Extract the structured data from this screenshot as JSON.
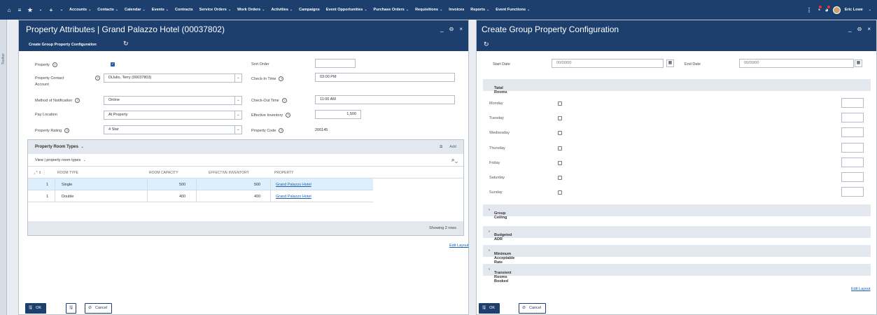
{
  "nav": {
    "items": [
      {
        "label": "Accounts",
        "chev": true
      },
      {
        "label": "Contacts",
        "chev": true
      },
      {
        "label": "Calendar",
        "chev": true
      },
      {
        "label": "Events",
        "chev": true
      },
      {
        "label": "Contracts",
        "chev": false
      },
      {
        "label": "Service Orders",
        "chev": true
      },
      {
        "label": "Work Orders",
        "chev": true
      },
      {
        "label": "Activities",
        "chev": true
      },
      {
        "label": "Campaigns",
        "chev": false
      },
      {
        "label": "Event Opportunities",
        "chev": true
      },
      {
        "label": "Purchase Orders",
        "chev": true
      },
      {
        "label": "Requisitions",
        "chev": true
      },
      {
        "label": "Invoices",
        "chev": false
      },
      {
        "label": "Reports",
        "chev": true
      },
      {
        "label": "Event Functions",
        "chev": true
      }
    ],
    "user_name": "Eric Lowe"
  },
  "toolbar_side": {
    "label": "Toolbar"
  },
  "left": {
    "title": "Property Attributes | Grand Palazzo Hotel (00037802)",
    "subtitle": "Create Group Property Configuration",
    "labels": {
      "property": "Property",
      "property_contact": "Property Contact",
      "property_contact_2": "Account",
      "method_notification": "Method of Notification",
      "pay_location": "Pay Location",
      "property_rating": "Property Rating",
      "sort_order": "Sort Order",
      "check_in": "Check-In Time",
      "check_out": "Check-Out Time",
      "effective_inventory": "Effective Inventory",
      "property_code": "Property Code"
    },
    "values": {
      "property_checked": true,
      "property_contact": "DiJulio, Terry (00037803)",
      "method_notification": "Online",
      "pay_location": "At Property",
      "property_rating": "4 Star",
      "sort_order": "",
      "check_in": "03:00 PM",
      "check_out": "11:00 AM",
      "effective_inventory": "1,500",
      "property_code": "200145"
    },
    "grid": {
      "title": "Property Room Types",
      "add_label": "Add",
      "view_text": "View | property room types",
      "columns": [
        "ROOM TYPE",
        "ROOM CAPACITY",
        "EFFECTIVE INVENTORY",
        "PROPERTY"
      ],
      "rows": [
        {
          "num": "1",
          "room_type": "Single",
          "capacity": "500",
          "inventory": "500",
          "property": "Grand Palazzo Hotel"
        },
        {
          "num": "1",
          "room_type": "Double",
          "capacity": "400",
          "inventory": "400",
          "property": "Grand Palazzo Hotel"
        }
      ],
      "footer": "Showing 2 rows"
    },
    "edit_layout": "Edit Layout",
    "ok_label": "OK",
    "cancel_label": "Cancel"
  },
  "right": {
    "title": "Create Group Property Configuration",
    "start_date_label": "Start Date",
    "start_date": "00/00/00",
    "end_date_label": "End Date",
    "end_date": "00/00/00",
    "total_rooms": "Total Rooms",
    "days": [
      "Monday",
      "Tuesday",
      "Wednesday",
      "Thursday",
      "Friday",
      "Saturday",
      "Sunday"
    ],
    "sections": [
      "Group Ceiling",
      "Budgeted ADR",
      "Minimum Acceptable Rate",
      "Transient Rooms Booked"
    ],
    "edit_layout": "Edit Layout",
    "ok_label": "OK",
    "cancel_label": "Cancel"
  }
}
